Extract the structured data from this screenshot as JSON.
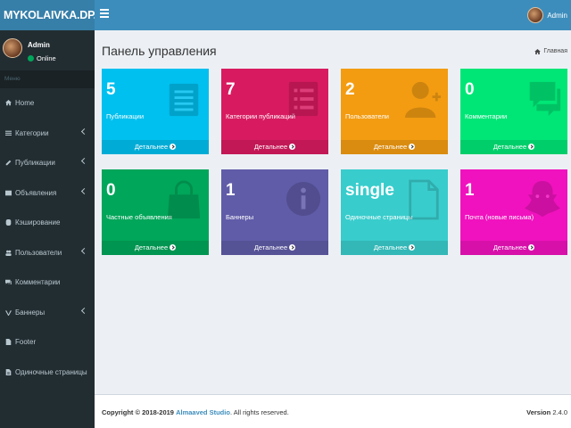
{
  "app": {
    "logo": "MYKOLAIVKA.DP.UA"
  },
  "topbar": {
    "user_name": "Admin"
  },
  "sidebar": {
    "user_name": "Admin",
    "status": "Online",
    "menu_header": "Меню",
    "items": [
      {
        "label": "Home",
        "icon": "home-icon",
        "has_children": false
      },
      {
        "label": "Категории",
        "icon": "list-icon",
        "has_children": true
      },
      {
        "label": "Публикации",
        "icon": "pencil-icon",
        "has_children": true
      },
      {
        "label": "Объявления",
        "icon": "newspaper-icon",
        "has_children": true
      },
      {
        "label": "Кэширование",
        "icon": "database-icon",
        "has_children": false
      },
      {
        "label": "Пользователи",
        "icon": "users-icon",
        "has_children": true
      },
      {
        "label": "Комментарии",
        "icon": "comments-icon",
        "has_children": false
      },
      {
        "label": "Баннеры",
        "icon": "vimeo-icon",
        "has_children": true
      },
      {
        "label": "Footer",
        "icon": "file-icon",
        "has_children": false
      },
      {
        "label": "Одиночные страницы",
        "icon": "file-text-icon",
        "has_children": false
      }
    ]
  },
  "header": {
    "title": "Панель управления",
    "breadcrumb": "Главная"
  },
  "boxes": [
    {
      "value": "5",
      "label": "Публикации",
      "footer": "Детальнее",
      "color": "#00c0ef",
      "icon": "document-icon"
    },
    {
      "value": "7",
      "label": "Категории публикаций",
      "footer": "Детальнее",
      "color": "#d81b60",
      "icon": "list-icon"
    },
    {
      "value": "2",
      "label": "Пользователи",
      "footer": "Детальнее",
      "color": "#f39c12",
      "icon": "user-add-icon"
    },
    {
      "value": "0",
      "label": "Комментарии",
      "footer": "Детальнее",
      "color": "#00e676",
      "icon": "chat-icon"
    },
    {
      "value": "0",
      "label": "Частные объявления",
      "footer": "Детальнее",
      "color": "#00a65a",
      "icon": "shopping-bag-icon"
    },
    {
      "value": "1",
      "label": "Баннеры",
      "footer": "Детальнее",
      "color": "#605ca8",
      "icon": "info-icon"
    },
    {
      "value": "single",
      "label": "Одиночные страницы",
      "footer": "Детальнее",
      "color": "#39cccc",
      "icon": "file-icon"
    },
    {
      "value": "1",
      "label": "Почта (новые письма)",
      "footer": "Детальнее",
      "color": "#f012be",
      "icon": "snapchat-icon"
    }
  ],
  "footer": {
    "copyright": "Copyright © 2018-2019",
    "studio": "Almaaved Studio",
    "rights": ". All rights reserved.",
    "version_label": "Version",
    "version": "2.4.0"
  }
}
